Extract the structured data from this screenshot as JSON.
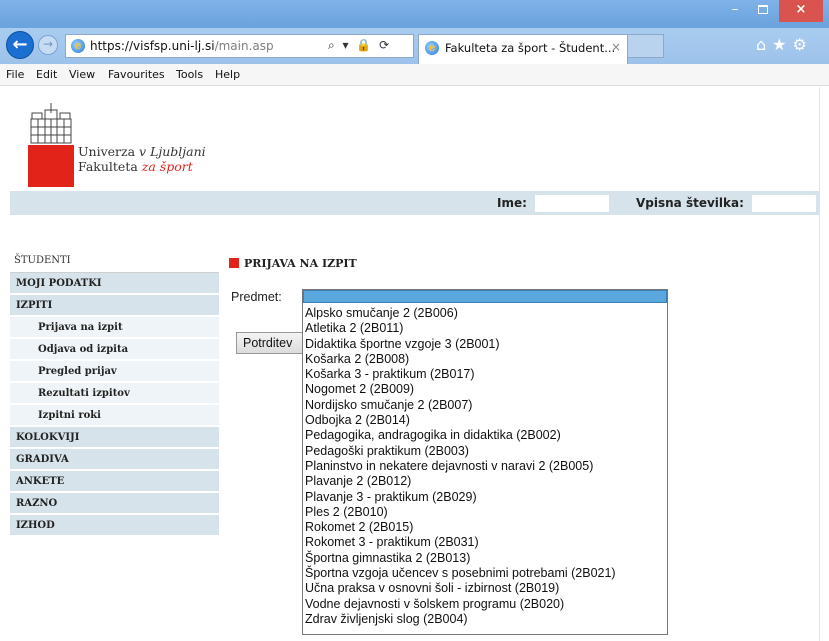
{
  "browser": {
    "url_host": "https://visfsp.uni-lj.si",
    "url_path": "/main.asp",
    "address_tools": "⌕ ▾ 🔒 ⟳",
    "tab_title": "Fakulteta za šport - Študent...",
    "tab_close": "×",
    "window_min": "–",
    "window_close": "×",
    "right_icons": "⌂★⚙"
  },
  "menu": {
    "items": [
      "File",
      "Edit",
      "View",
      "Favourites",
      "Tools",
      "Help"
    ]
  },
  "logo": {
    "line1_a": "Univerza ",
    "line1_b": "v Ljubljani",
    "line2_a": "Fakulteta ",
    "line2_b": "za šport"
  },
  "info": {
    "name_label": "Ime:",
    "id_label": "Vpisna številka:"
  },
  "sidebar": {
    "header": "ŠTUDENTI",
    "items": [
      {
        "label": "MOJI PODATKI",
        "level": 0
      },
      {
        "label": "IZPITI",
        "level": 0
      },
      {
        "label": "Prijava na izpit",
        "level": 1
      },
      {
        "label": "Odjava od izpita",
        "level": 1
      },
      {
        "label": "Pregled prijav",
        "level": 1
      },
      {
        "label": "Rezultati izpitov",
        "level": 1
      },
      {
        "label": "Izpitni roki",
        "level": 1
      },
      {
        "label": "KOLOKVIJI",
        "level": 0
      },
      {
        "label": "GRADIVA",
        "level": 0
      },
      {
        "label": "ANKETE",
        "level": 0
      },
      {
        "label": "RAZNO",
        "level": 0
      },
      {
        "label": "IZHOD",
        "level": 0
      }
    ]
  },
  "form": {
    "title": "PRIJAVA NA IZPIT",
    "subject_label": "Predmet:",
    "submit_label": "Potrditev",
    "selected_value": "",
    "options": [
      "Alpsko smučanje 2 (2B006)",
      "Atletika 2 (2B011)",
      "Didaktika športne vzgoje 3 (2B001)",
      "Košarka 2 (2B008)",
      "Košarka 3 - praktikum (2B017)",
      "Nogomet 2 (2B009)",
      "Nordijsko smučanje 2 (2B007)",
      "Odbojka 2 (2B014)",
      "Pedagogika, andragogika in didaktika (2B002)",
      "Pedagoški praktikum (2B003)",
      "Planinstvo in nekatere dejavnosti v naravi 2 (2B005)",
      "Plavanje 2 (2B012)",
      "Plavanje 3 - praktikum (2B029)",
      "Ples 2 (2B010)",
      "Rokomet 2 (2B015)",
      "Rokomet 3 - praktikum (2B031)",
      "Športna gimnastika 2 (2B013)",
      "Športna vzgoja učencev s posebnimi potrebami (2B021)",
      "Učna praksa v osnovni šoli - izbirnost (2B019)",
      "Vodne dejavnosti v šolskem programu (2B020)",
      "Zdrav življenjski slog (2B004)"
    ]
  },
  "colors": {
    "accent_red": "#e2231a",
    "info_bar": "#d6e3ea",
    "selected_option": "#5aa7dd"
  }
}
